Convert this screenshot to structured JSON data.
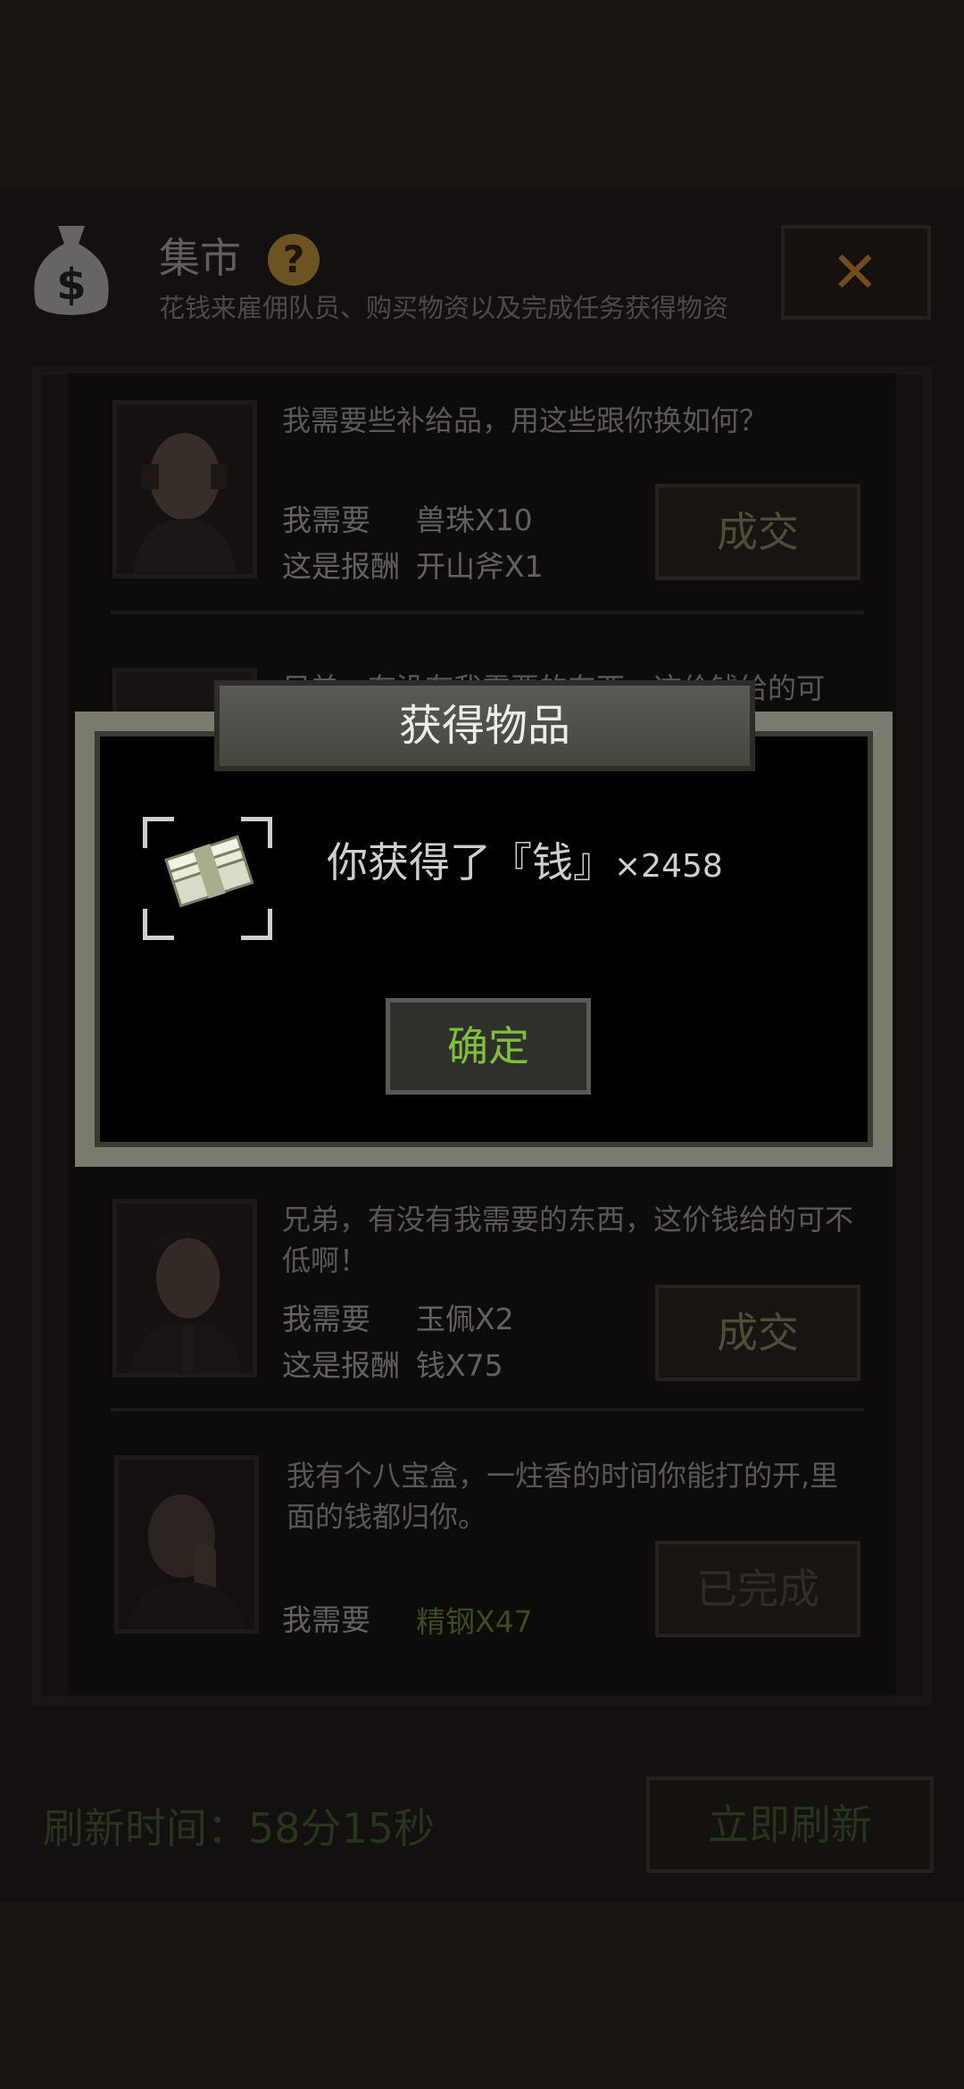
{
  "market": {
    "title": "集市",
    "subtitle": "花钱来雇佣队员、购买物资以及完成任务获得物资",
    "help_icon": "?",
    "close_icon": "✕"
  },
  "trades": [
    {
      "quote": "我需要些补给品，用这些跟你换如何？",
      "need_label": "我需要",
      "need_value": "兽珠X10",
      "reward_label": "这是报酬",
      "reward_value": "开山斧X1",
      "button": "成交"
    },
    {
      "quote": "兄弟，有没有我需要的东西，这价钱给的可"
    },
    {
      "quote": "兄弟，有没有我需要的东西，这价钱给的可不低啊！",
      "need_label": "我需要",
      "need_value": "玉佩X2",
      "reward_label": "这是报酬",
      "reward_value": "钱X75",
      "button": "成交"
    },
    {
      "quote": "我有个八宝盒，一炷香的时间你能打的开,里面的钱都归你。",
      "need_label": "我需要",
      "need_value": "精钢X47",
      "button": "已完成"
    }
  ],
  "footer": {
    "refresh_time": "刷新时间：58分15秒",
    "refresh_button": "立即刷新"
  },
  "modal": {
    "title": "获得物品",
    "message": "你获得了『钱』",
    "multiplier": "×2458",
    "confirm": "确定"
  },
  "icons": [
    "money-bag-icon",
    "help-icon",
    "close-icon",
    "money-stack-icon"
  ],
  "colors": {
    "accent_green": "#7fbf3a",
    "help_yellow": "#e2b23a",
    "close_orange": "#f0a030"
  }
}
